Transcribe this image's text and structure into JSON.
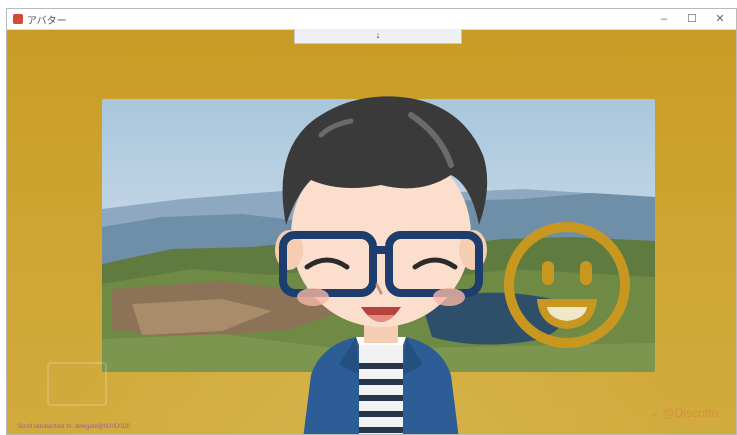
{
  "window": {
    "title": "アバター",
    "controls": {
      "minimize": "–",
      "maximize": "☐",
      "close": "✕"
    }
  },
  "overlay_bar": {
    "glyph": "↓"
  },
  "scene": {
    "avatar": "cartoon person with glasses",
    "smiley": "laughing-face",
    "background": "mountain lake landscape"
  },
  "footer": {
    "left_text": "Scroll sidebar/text to: delegate@0D0D0D0",
    "right_text": "→ @Discotto"
  },
  "colors": {
    "stage": "#c9a22f",
    "smiley_ring": "#c8971f",
    "jacket": "#2c5d96",
    "glasses": "#1c3d6e"
  }
}
